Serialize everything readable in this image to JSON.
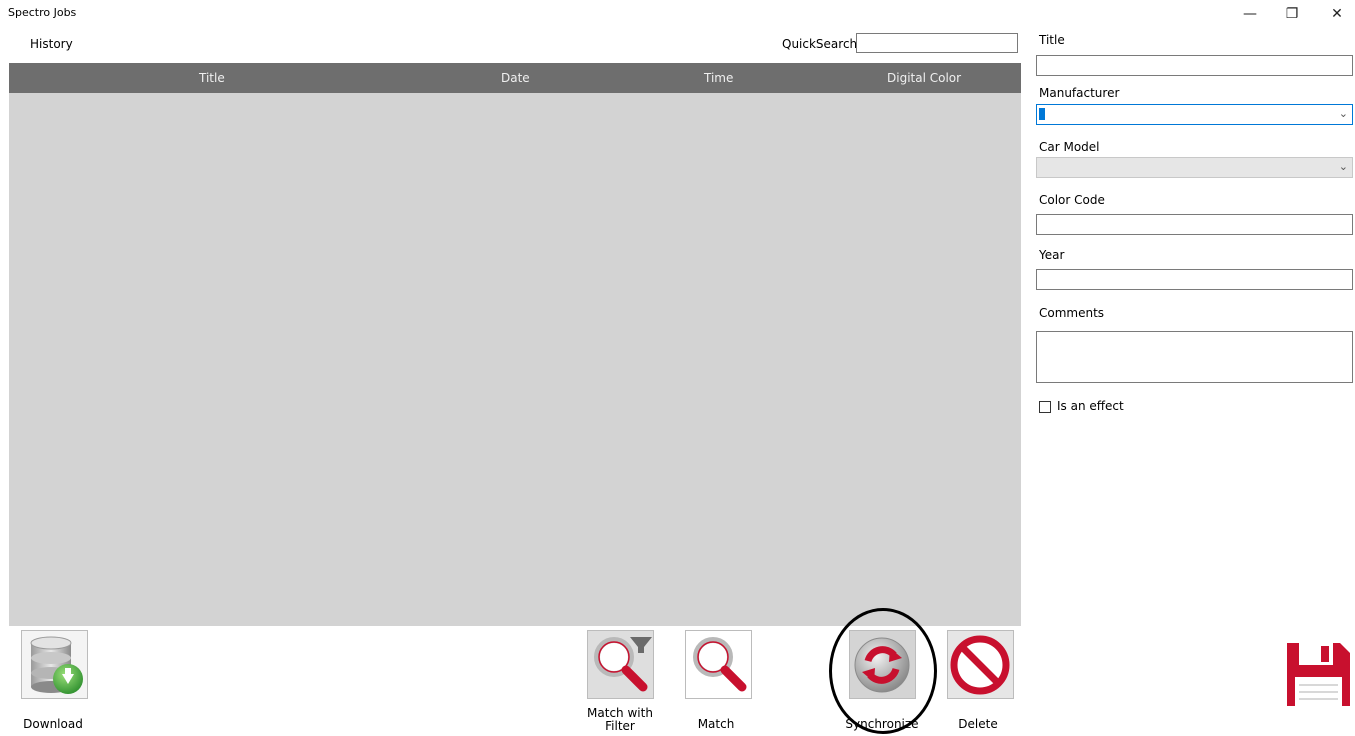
{
  "window": {
    "title": "Spectro Jobs",
    "controls": {
      "minimize": "—",
      "restore": "❐",
      "close": "✕"
    }
  },
  "history": {
    "label": "History"
  },
  "search": {
    "label": "QuickSearch",
    "value": ""
  },
  "grid": {
    "columns": [
      "Title",
      "Date",
      "Time",
      "Digital Color"
    ],
    "rows": []
  },
  "toolbar": {
    "download_label": "Download",
    "match_filter_label_1": "Match with",
    "match_filter_label_2": "Filter",
    "match_label": "Match",
    "synchronize_label": "Synchronize",
    "delete_label": "Delete"
  },
  "details": {
    "title_label": "Title",
    "title_value": "",
    "manufacturer_label": "Manufacturer",
    "manufacturer_value": "",
    "car_model_label": "Car Model",
    "car_model_value": "",
    "color_code_label": "Color Code",
    "color_code_value": "",
    "year_label": "Year",
    "year_value": "",
    "comments_label": "Comments",
    "comments_value": "",
    "effect_label": "Is an effect",
    "effect_checked": false
  },
  "colors": {
    "grid_header": "#6e6e6e",
    "grid_body": "#d3d3d3",
    "focus_border": "#0078d7",
    "accent_red": "#c8102e",
    "download_green": "#3aa63a"
  },
  "icons": {
    "download": "database-download-icon",
    "match_filter": "magnifier-filter-icon",
    "match": "magnifier-icon",
    "synchronize": "sync-icon",
    "delete": "prohibited-icon",
    "save": "floppy-disk-icon"
  }
}
